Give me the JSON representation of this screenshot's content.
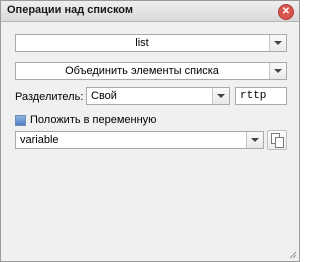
{
  "window": {
    "title": "Операции над списком",
    "close_icon": "close-icon"
  },
  "list_select": {
    "value": "list"
  },
  "operation_select": {
    "value": "Объединить элементы списка"
  },
  "separator": {
    "label": "Разделитель:",
    "type_value": "Свой",
    "custom_value": "rttp"
  },
  "save_to_var": {
    "label": "Положить в переменную"
  },
  "variable_select": {
    "value": "variable"
  },
  "icons": {
    "copy": "copy-icon",
    "resize": "resize-grip-icon"
  }
}
